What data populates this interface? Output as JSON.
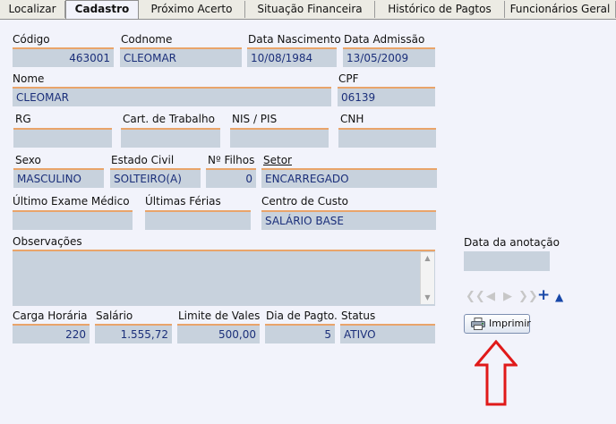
{
  "tabs": [
    {
      "label": "Localizar"
    },
    {
      "label": "Cadastro",
      "active": true
    },
    {
      "label": "Próximo Acerto"
    },
    {
      "label": "Situação Financeira"
    },
    {
      "label": "Histórico de Pagtos"
    },
    {
      "label": "Funcionários Geral"
    }
  ],
  "form": {
    "codigo": {
      "label": "Código",
      "value": "463001"
    },
    "codnome": {
      "label": "Codnome",
      "value": "CLEOMAR"
    },
    "nascimento": {
      "label": "Data Nascimento",
      "value": "10/08/1984"
    },
    "admissao": {
      "label": "Data Admissão",
      "value": "13/05/2009"
    },
    "nome": {
      "label": "Nome",
      "value": "CLEOMAR"
    },
    "cpf": {
      "label": "CPF",
      "value": "06139"
    },
    "rg": {
      "label": "RG",
      "value": ""
    },
    "carteira": {
      "label": "Cart. de Trabalho",
      "value": ""
    },
    "nis": {
      "label": "NIS / PIS",
      "value": ""
    },
    "cnh": {
      "label": "CNH",
      "value": ""
    },
    "sexo": {
      "label": "Sexo",
      "value": "MASCULINO"
    },
    "estado_civil": {
      "label": "Estado Civil",
      "value": "SOLTEIRO(A)"
    },
    "filhos": {
      "label": "Nº Filhos",
      "value": "0"
    },
    "setor": {
      "label": "Setor",
      "value": "ENCARREGADO"
    },
    "exame": {
      "label": "Último Exame Médico",
      "value": ""
    },
    "ferias": {
      "label": "Últimas Férias",
      "value": ""
    },
    "centro_custo": {
      "label": "Centro de Custo",
      "value": "SALÁRIO BASE"
    },
    "observacoes": {
      "label": "Observações",
      "value": ""
    },
    "data_anotacao": {
      "label": "Data da anotação",
      "value": ""
    },
    "carga": {
      "label": "Carga Horária",
      "value": "220"
    },
    "salario": {
      "label": "Salário",
      "value": "1.555,72"
    },
    "vales": {
      "label": "Limite de Vales",
      "value": "500,00"
    },
    "dia_pagto": {
      "label": "Dia de Pagto.",
      "value": "5"
    },
    "status": {
      "label": "Status",
      "value": "ATIVO"
    }
  },
  "actions": {
    "imprimir": "Imprimir"
  },
  "nav_icons": [
    "first-icon",
    "prev-icon",
    "next-icon",
    "last-icon",
    "add-icon",
    "up-icon"
  ],
  "colors": {
    "field_bg": "#c8d2dd",
    "field_accent": "#e9a46a",
    "field_text": "#1b2f7a",
    "page_bg": "#f2f3fb",
    "arrow": "#e01919"
  }
}
